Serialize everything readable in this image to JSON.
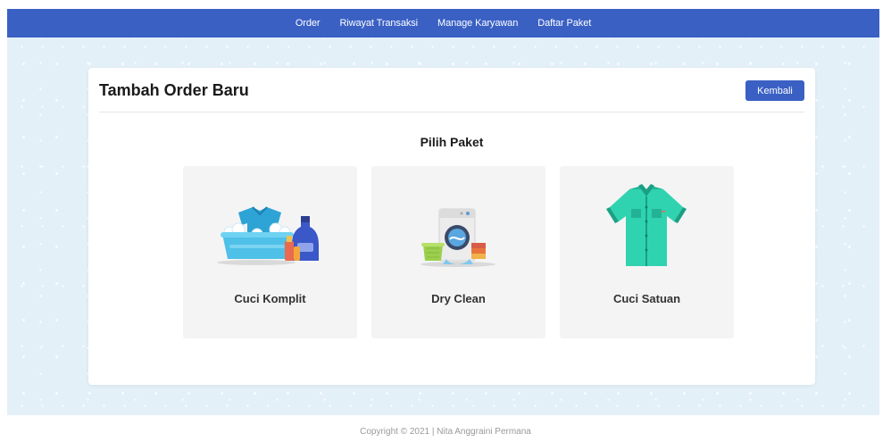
{
  "navbar": {
    "items": [
      {
        "label": "Order"
      },
      {
        "label": "Riwayat Transaksi"
      },
      {
        "label": "Manage Karyawan"
      },
      {
        "label": "Daftar Paket"
      }
    ]
  },
  "card": {
    "title": "Tambah Order Baru",
    "back_label": "Kembali",
    "section_title": "Pilih Paket",
    "packages": [
      {
        "label": "Cuci Komplit",
        "icon": "laundry-basket-icon"
      },
      {
        "label": "Dry Clean",
        "icon": "washing-machine-icon"
      },
      {
        "label": "Cuci Satuan",
        "icon": "shirt-icon"
      }
    ]
  },
  "footer": {
    "text": "Copyright © 2021 | Nita Anggraini Permana"
  },
  "colors": {
    "primary": "#3a60c4",
    "background": "#e4f0f8",
    "card": "#ffffff",
    "package_bg": "#f4f4f4"
  }
}
